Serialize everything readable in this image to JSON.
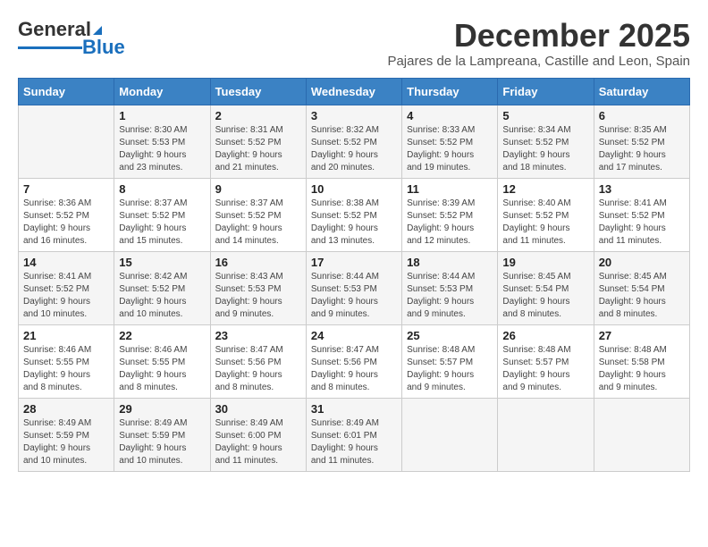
{
  "header": {
    "logo_general": "General",
    "logo_blue": "Blue",
    "month": "December 2025",
    "location": "Pajares de la Lampreana, Castille and Leon, Spain"
  },
  "days_of_week": [
    "Sunday",
    "Monday",
    "Tuesday",
    "Wednesday",
    "Thursday",
    "Friday",
    "Saturday"
  ],
  "weeks": [
    [
      {
        "day": "",
        "info": ""
      },
      {
        "day": "1",
        "info": "Sunrise: 8:30 AM\nSunset: 5:53 PM\nDaylight: 9 hours\nand 23 minutes."
      },
      {
        "day": "2",
        "info": "Sunrise: 8:31 AM\nSunset: 5:52 PM\nDaylight: 9 hours\nand 21 minutes."
      },
      {
        "day": "3",
        "info": "Sunrise: 8:32 AM\nSunset: 5:52 PM\nDaylight: 9 hours\nand 20 minutes."
      },
      {
        "day": "4",
        "info": "Sunrise: 8:33 AM\nSunset: 5:52 PM\nDaylight: 9 hours\nand 19 minutes."
      },
      {
        "day": "5",
        "info": "Sunrise: 8:34 AM\nSunset: 5:52 PM\nDaylight: 9 hours\nand 18 minutes."
      },
      {
        "day": "6",
        "info": "Sunrise: 8:35 AM\nSunset: 5:52 PM\nDaylight: 9 hours\nand 17 minutes."
      }
    ],
    [
      {
        "day": "7",
        "info": "Sunrise: 8:36 AM\nSunset: 5:52 PM\nDaylight: 9 hours\nand 16 minutes."
      },
      {
        "day": "8",
        "info": "Sunrise: 8:37 AM\nSunset: 5:52 PM\nDaylight: 9 hours\nand 15 minutes."
      },
      {
        "day": "9",
        "info": "Sunrise: 8:37 AM\nSunset: 5:52 PM\nDaylight: 9 hours\nand 14 minutes."
      },
      {
        "day": "10",
        "info": "Sunrise: 8:38 AM\nSunset: 5:52 PM\nDaylight: 9 hours\nand 13 minutes."
      },
      {
        "day": "11",
        "info": "Sunrise: 8:39 AM\nSunset: 5:52 PM\nDaylight: 9 hours\nand 12 minutes."
      },
      {
        "day": "12",
        "info": "Sunrise: 8:40 AM\nSunset: 5:52 PM\nDaylight: 9 hours\nand 11 minutes."
      },
      {
        "day": "13",
        "info": "Sunrise: 8:41 AM\nSunset: 5:52 PM\nDaylight: 9 hours\nand 11 minutes."
      }
    ],
    [
      {
        "day": "14",
        "info": "Sunrise: 8:41 AM\nSunset: 5:52 PM\nDaylight: 9 hours\nand 10 minutes."
      },
      {
        "day": "15",
        "info": "Sunrise: 8:42 AM\nSunset: 5:52 PM\nDaylight: 9 hours\nand 10 minutes."
      },
      {
        "day": "16",
        "info": "Sunrise: 8:43 AM\nSunset: 5:53 PM\nDaylight: 9 hours\nand 9 minutes."
      },
      {
        "day": "17",
        "info": "Sunrise: 8:44 AM\nSunset: 5:53 PM\nDaylight: 9 hours\nand 9 minutes."
      },
      {
        "day": "18",
        "info": "Sunrise: 8:44 AM\nSunset: 5:53 PM\nDaylight: 9 hours\nand 9 minutes."
      },
      {
        "day": "19",
        "info": "Sunrise: 8:45 AM\nSunset: 5:54 PM\nDaylight: 9 hours\nand 8 minutes."
      },
      {
        "day": "20",
        "info": "Sunrise: 8:45 AM\nSunset: 5:54 PM\nDaylight: 9 hours\nand 8 minutes."
      }
    ],
    [
      {
        "day": "21",
        "info": "Sunrise: 8:46 AM\nSunset: 5:55 PM\nDaylight: 9 hours\nand 8 minutes."
      },
      {
        "day": "22",
        "info": "Sunrise: 8:46 AM\nSunset: 5:55 PM\nDaylight: 9 hours\nand 8 minutes."
      },
      {
        "day": "23",
        "info": "Sunrise: 8:47 AM\nSunset: 5:56 PM\nDaylight: 9 hours\nand 8 minutes."
      },
      {
        "day": "24",
        "info": "Sunrise: 8:47 AM\nSunset: 5:56 PM\nDaylight: 9 hours\nand 8 minutes."
      },
      {
        "day": "25",
        "info": "Sunrise: 8:48 AM\nSunset: 5:57 PM\nDaylight: 9 hours\nand 9 minutes."
      },
      {
        "day": "26",
        "info": "Sunrise: 8:48 AM\nSunset: 5:57 PM\nDaylight: 9 hours\nand 9 minutes."
      },
      {
        "day": "27",
        "info": "Sunrise: 8:48 AM\nSunset: 5:58 PM\nDaylight: 9 hours\nand 9 minutes."
      }
    ],
    [
      {
        "day": "28",
        "info": "Sunrise: 8:49 AM\nSunset: 5:59 PM\nDaylight: 9 hours\nand 10 minutes."
      },
      {
        "day": "29",
        "info": "Sunrise: 8:49 AM\nSunset: 5:59 PM\nDaylight: 9 hours\nand 10 minutes."
      },
      {
        "day": "30",
        "info": "Sunrise: 8:49 AM\nSunset: 6:00 PM\nDaylight: 9 hours\nand 11 minutes."
      },
      {
        "day": "31",
        "info": "Sunrise: 8:49 AM\nSunset: 6:01 PM\nDaylight: 9 hours\nand 11 minutes."
      },
      {
        "day": "",
        "info": ""
      },
      {
        "day": "",
        "info": ""
      },
      {
        "day": "",
        "info": ""
      }
    ]
  ]
}
